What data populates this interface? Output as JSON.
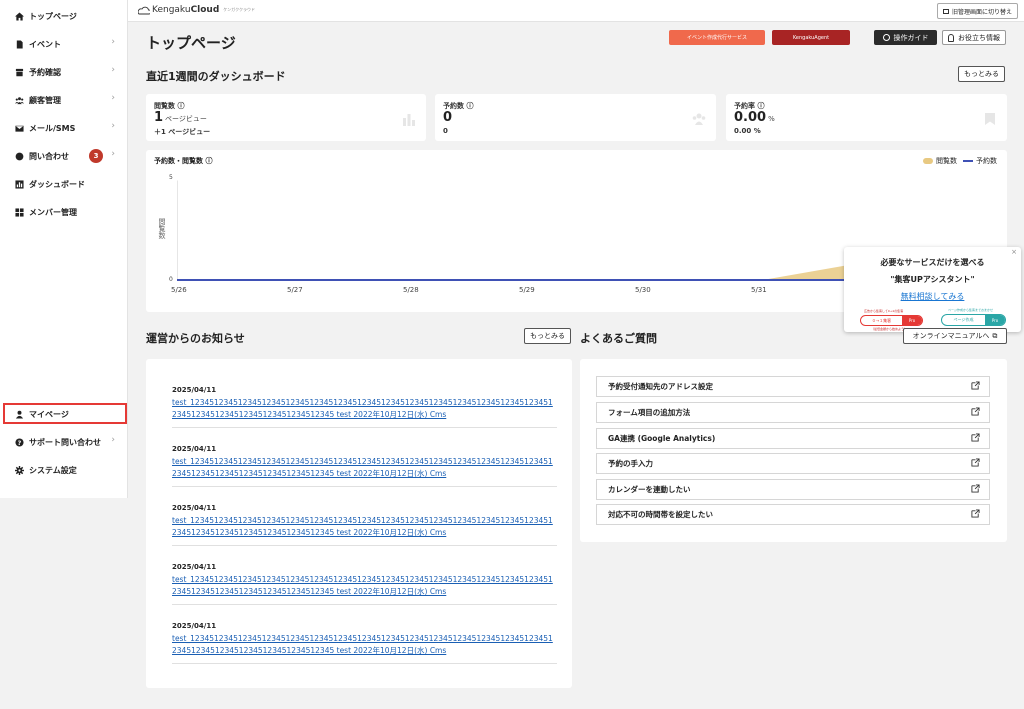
{
  "sidebar": {
    "items": [
      {
        "label": "トップページ",
        "icon": "home-icon"
      },
      {
        "label": "イベント",
        "icon": "document-icon"
      },
      {
        "label": "予約確認",
        "icon": "inbox-icon"
      },
      {
        "label": "顧客管理",
        "icon": "users-icon"
      },
      {
        "label": "メール/SMS",
        "icon": "mail-icon"
      },
      {
        "label": "問い合わせ",
        "icon": "chat-icon",
        "badge": "3"
      },
      {
        "label": "ダッシュボード",
        "icon": "chart-icon"
      },
      {
        "label": "メンバー管理",
        "icon": "grid-icon"
      }
    ],
    "bottom_items": [
      {
        "label": "マイページ",
        "icon": "person-icon"
      },
      {
        "label": "サポート問い合わせ",
        "icon": "help-icon"
      },
      {
        "label": "システム設定",
        "icon": "gear-icon"
      }
    ]
  },
  "header": {
    "logo_prefix": "Kengaku",
    "logo_bold": "Cloud",
    "logo_sub": "ケンガククラウド",
    "switch_button": "旧管理画面に切り替え"
  },
  "page": {
    "title": "トップページ",
    "btn_event_service": "イベント作成代行サービス",
    "btn_agent": "KengakuAgent",
    "btn_guide": "操作ガイド",
    "btn_info": "お役立ち情報"
  },
  "dashboard": {
    "title": "直近1週間のダッシュボード",
    "more": "もっとみる",
    "stats": [
      {
        "label": "閲覧数",
        "value": "1",
        "unit": "ページビュー",
        "sub": "＋1 ページビュー"
      },
      {
        "label": "予約数",
        "value": "0",
        "unit": "",
        "sub": "0"
      },
      {
        "label": "予約率",
        "value": "0.00",
        "unit": "%",
        "sub": "0.00 %"
      }
    ]
  },
  "chart_data": {
    "type": "area",
    "title": "予約数・閲覧数",
    "ylabel": "閲覧数",
    "x": [
      "5/26",
      "5/27",
      "5/28",
      "5/29",
      "5/30",
      "5/31",
      "6/1"
    ],
    "xtick_labels": [
      "5/26",
      "5/27",
      "5/28",
      "5/29",
      "5/30",
      "5/31"
    ],
    "yticks": [
      "5",
      "0"
    ],
    "ylim": [
      0,
      5
    ],
    "legend_position": "top-right",
    "series": [
      {
        "name": "閲覧数",
        "type": "area",
        "color": "#e8c982",
        "values": [
          0,
          0,
          0,
          0,
          0,
          0,
          1
        ]
      },
      {
        "name": "予約数",
        "type": "line",
        "color": "#3f51b5",
        "values": [
          0,
          0,
          0,
          0,
          0,
          0,
          0
        ]
      }
    ]
  },
  "popup": {
    "close": "×",
    "line1": "必要なサービスだけを選べる",
    "line2": "\"集客UPアシスタント\"",
    "link": "無料相談してみる",
    "note_left": "広告から集客して0→1の集客",
    "note_left2": "（最低金額から始めよう）",
    "note_right": "ページ作成から集客までおまかせ",
    "pill1_text": "０→１集客",
    "pill1_tag": "Pro",
    "pill2_text": "ページ作成",
    "pill2_tag": "Pro"
  },
  "news": {
    "title": "運営からのお知らせ",
    "more": "もっとみる",
    "items": [
      {
        "date": "2025/04/11",
        "text": "test_12345123451234512345123451234512345123451234512345123451234512345123451234512345123451234512345123451234512345 test 2022年10月12日(水) Cms"
      },
      {
        "date": "2025/04/11",
        "text": "test_12345123451234512345123451234512345123451234512345123451234512345123451234512345123451234512345123451234512345 test 2022年10月12日(水) Cms"
      },
      {
        "date": "2025/04/11",
        "text": "test_12345123451234512345123451234512345123451234512345123451234512345123451234512345123451234512345123451234512345 test 2022年10月12日(水) Cms"
      },
      {
        "date": "2025/04/11",
        "text": "test_12345123451234512345123451234512345123451234512345123451234512345123451234512345123451234512345123451234512345 test 2022年10月12日(水) Cms"
      },
      {
        "date": "2025/04/11",
        "text": "test_12345123451234512345123451234512345123451234512345123451234512345123451234512345123451234512345123451234512345 test 2022年10月12日(水) Cms"
      }
    ]
  },
  "faq": {
    "title": "よくあるご質問",
    "manual": "オンラインマニュアルへ",
    "items": [
      "予約受付通知先のアドレス設定",
      "フォーム項目の追加方法",
      "GA連携 (Google Analytics)",
      "予約の手入力",
      "カレンダーを連動したい",
      "対応不可の時間帯を設定したい"
    ]
  }
}
